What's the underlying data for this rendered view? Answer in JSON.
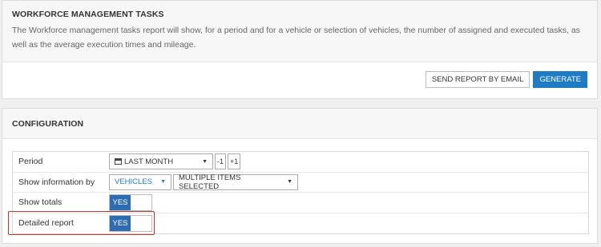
{
  "header": {
    "title": "WORKFORCE MANAGEMENT TASKS",
    "description": "The Workforce management tasks report will show, for a period and for a vehicle or selection of vehicles, the number of assigned and executed tasks, as well as the average execution times and mileage.",
    "send_email_label": "SEND REPORT BY EMAIL",
    "generate_label": "GENERATE"
  },
  "config": {
    "title": "CONFIGURATION",
    "period": {
      "label": "Period",
      "value": "LAST MONTH",
      "minus_label": "-1",
      "plus_label": "+1"
    },
    "show_info": {
      "label": "Show information by",
      "type_value": "VEHICLES",
      "items_value": "MULTIPLE ITEMS SELECTED"
    },
    "show_totals": {
      "label": "Show totals",
      "toggle_label": "YES"
    },
    "detailed_report": {
      "label": "Detailed report",
      "toggle_label": "YES"
    }
  },
  "colors": {
    "primary": "#1f7bc4",
    "toggle_on": "#2d6cb5",
    "highlight": "#c0392b"
  },
  "icons": {
    "calendar": "calendar-icon",
    "caret": "caret-down-icon"
  }
}
